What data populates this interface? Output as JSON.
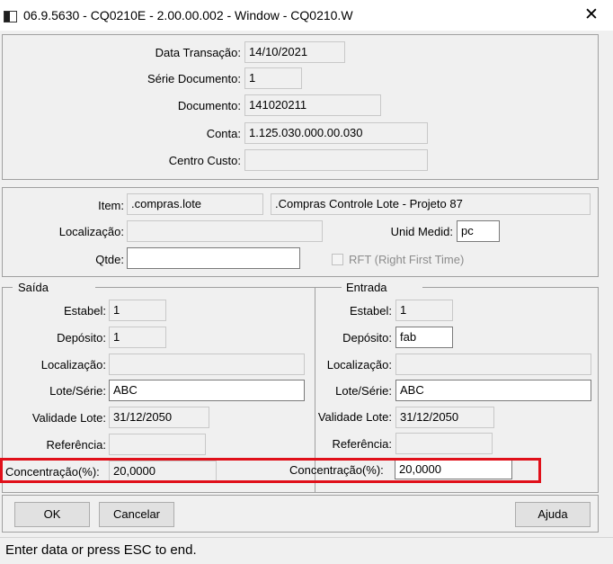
{
  "window": {
    "title": "06.9.5630 - CQ0210E - 2.00.00.002 - Window - CQ0210.W",
    "close_glyph": "✕"
  },
  "header": {
    "data_transacao": {
      "label": "Data Transação:",
      "value": "14/10/2021"
    },
    "serie_documento": {
      "label": "Série Documento:",
      "value": "1"
    },
    "documento": {
      "label": "Documento:",
      "value": "141020211"
    },
    "conta": {
      "label": "Conta:",
      "value": "1.125.030.000.00.030"
    },
    "centro_custo": {
      "label": "Centro Custo:",
      "value": ""
    }
  },
  "item": {
    "item_label": "Item:",
    "item_value": ".compras.lote",
    "item_desc": ".Compras Controle Lote - Projeto 87",
    "localizacao_label": "Localização:",
    "localizacao_value": "",
    "unid_medid_label": "Unid Medid:",
    "unid_medid_value": "pc",
    "qtde_label": "Qtde:",
    "qtde_value": "",
    "rft_label": "RFT (Right First Time)"
  },
  "saida": {
    "title": "Saída",
    "estabel": {
      "label": "Estabel:",
      "value": "1"
    },
    "deposito": {
      "label": "Depósito:",
      "value": "1"
    },
    "localizacao": {
      "label": "Localização:",
      "value": ""
    },
    "lote_serie": {
      "label": "Lote/Série:",
      "value": "ABC"
    },
    "validade_lote": {
      "label": "Validade Lote:",
      "value": "31/12/2050"
    },
    "referencia": {
      "label": "Referência:",
      "value": ""
    },
    "concentracao": {
      "label": "Concentração(%):",
      "value": "20,0000"
    }
  },
  "entrada": {
    "title": "Entrada",
    "estabel": {
      "label": "Estabel:",
      "value": "1"
    },
    "deposito": {
      "label": "Depósito:",
      "value": "fab"
    },
    "localizacao": {
      "label": "Localização:",
      "value": ""
    },
    "lote_serie": {
      "label": "Lote/Série:",
      "value": "ABC"
    },
    "validade_lote": {
      "label": "Validade Lote:",
      "value": "31/12/2050"
    },
    "referencia": {
      "label": "Referência:",
      "value": ""
    },
    "concentracao": {
      "label": "Concentração(%):",
      "value": "20,0000"
    }
  },
  "buttons": {
    "ok": "OK",
    "cancelar": "Cancelar",
    "ajuda": "Ajuda"
  },
  "status": {
    "text": "Enter data or press ESC to end."
  },
  "colors": {
    "highlight": "#e0101a"
  }
}
